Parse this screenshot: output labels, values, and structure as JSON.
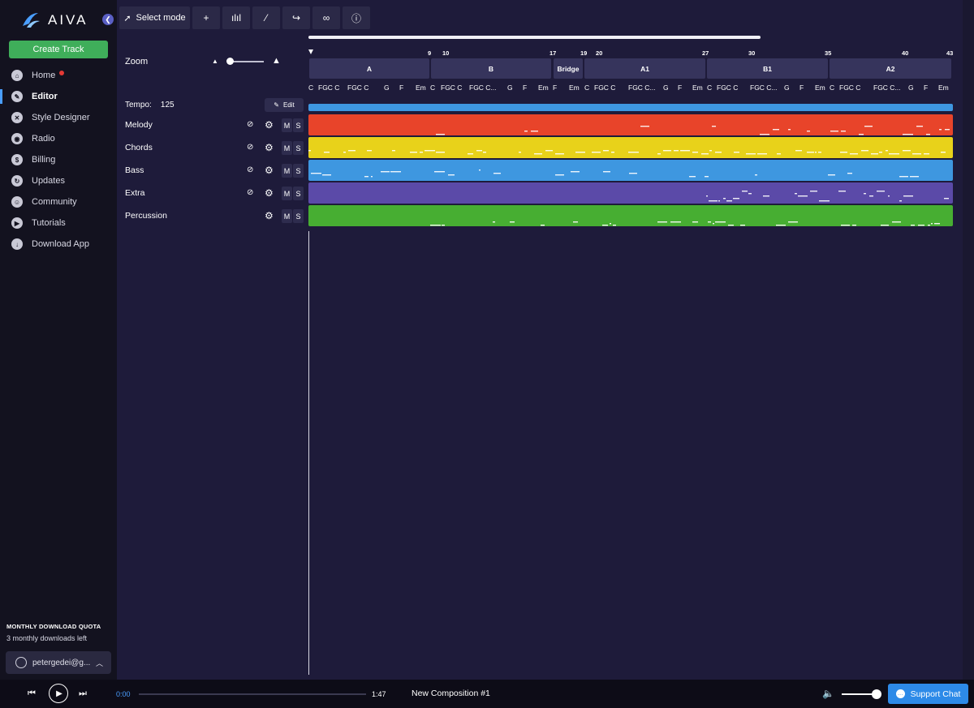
{
  "app": {
    "logo_text": "AIVA"
  },
  "sidebar": {
    "collapse_icon": "chevron-left-icon",
    "create_track_label": "Create Track",
    "items": [
      {
        "label": "Home",
        "icon": "home-icon",
        "badge": true
      },
      {
        "label": "Editor",
        "icon": "pencil-icon",
        "active": true
      },
      {
        "label": "Style Designer",
        "icon": "style-icon"
      },
      {
        "label": "Radio",
        "icon": "radio-icon"
      },
      {
        "label": "Billing",
        "icon": "dollar-icon"
      },
      {
        "label": "Updates",
        "icon": "refresh-icon"
      },
      {
        "label": "Community",
        "icon": "discord-icon"
      },
      {
        "label": "Tutorials",
        "icon": "play-icon"
      },
      {
        "label": "Download App",
        "icon": "download-icon"
      }
    ],
    "quota_title": "MONTHLY DOWNLOAD QUOTA",
    "quota_text": "3 monthly downloads left",
    "user": "petergedei@g..."
  },
  "toolbar": {
    "select_mode_label": "Select mode",
    "buttons": [
      "plus-icon",
      "bars-icon",
      "wand-icon",
      "redo-icon",
      "link-icon",
      "info-icon"
    ]
  },
  "editor": {
    "zoom_label": "Zoom",
    "tempo_label": "Tempo:",
    "tempo_value": "125",
    "edit_label": "Edit",
    "zoom_level": 0.1
  },
  "tracks": [
    {
      "name": "Melody",
      "color": "#e8442a"
    },
    {
      "name": "Chords",
      "color": "#e8d21a"
    },
    {
      "name": "Bass",
      "color": "#3e97e0"
    },
    {
      "name": "Extra",
      "color": "#5b4aa8"
    },
    {
      "name": "Percussion",
      "color": "#47ae32"
    }
  ],
  "ruler": {
    "bar_numbers": [
      "9",
      "10",
      "17",
      "19",
      "20",
      "27",
      "30",
      "35",
      "40",
      "43"
    ]
  },
  "sections": [
    "A",
    "B",
    "Bridge",
    "A1",
    "B1",
    "A2"
  ],
  "chords": [
    "C",
    "FGC C",
    "FGC C",
    "G",
    "F",
    "Em",
    "C",
    "FGC C",
    "FGC C...",
    "G",
    "F",
    "Em",
    "F",
    "Em",
    "C",
    "FGC C",
    "FGC C...",
    "G",
    "F",
    "Em",
    "C",
    "FGC C",
    "FGC C...",
    "G",
    "F",
    "Em",
    "C",
    "FGC C",
    "FGC C...",
    "G",
    "F",
    "Em"
  ],
  "colors": {
    "accent": "#4a9eff",
    "create": "#3fae5a",
    "tempo_strip": "#3e97e0"
  },
  "player": {
    "current_time": "0:00",
    "duration": "1:47",
    "title": "New Composition #1",
    "support_label": "Support Chat",
    "volume": 0.9
  }
}
